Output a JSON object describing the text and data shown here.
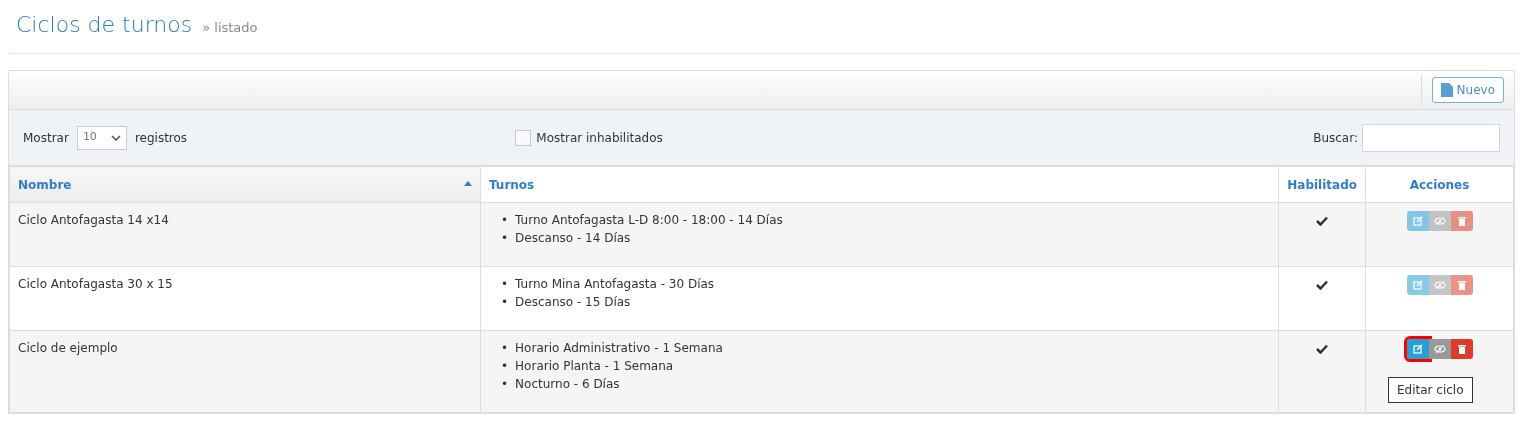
{
  "page": {
    "title": "Ciclos de turnos",
    "subtitle": "» listado"
  },
  "toolbar": {
    "new_button": "Nuevo"
  },
  "filters": {
    "show_label": "Mostrar",
    "page_size": "10",
    "records_label": "registros",
    "show_disabled": {
      "label": "Mostrar inhabilitados",
      "checked": false
    },
    "search_label": "Buscar:"
  },
  "table": {
    "columns": [
      {
        "label": "Nombre",
        "sorted": true
      },
      {
        "label": "Turnos",
        "sorted": false
      },
      {
        "label": "Habilitado",
        "sorted": false
      },
      {
        "label": "Acciones",
        "sorted": false
      }
    ],
    "rows": [
      {
        "name": "Ciclo Antofagasta 14 x14",
        "shifts": [
          "Turno Antofagasta L-D 8:00 - 18:00 - 14 Días",
          "Descanso - 14 Días"
        ],
        "enabled": true,
        "hovered": false
      },
      {
        "name": "Ciclo Antofagasta 30 x 15",
        "shifts": [
          "Turno Mina Antofagasta - 30 Días",
          "Descanso - 15 Días"
        ],
        "enabled": true,
        "hovered": false
      },
      {
        "name": "Ciclo de ejemplo",
        "shifts": [
          "Horario Administrativo - 1 Semana",
          "Horario Planta - 1 Semana",
          "Nocturno - 6 Días"
        ],
        "enabled": true,
        "hovered": true
      }
    ]
  },
  "bullet": "•",
  "tooltip": "Editar ciclo"
}
